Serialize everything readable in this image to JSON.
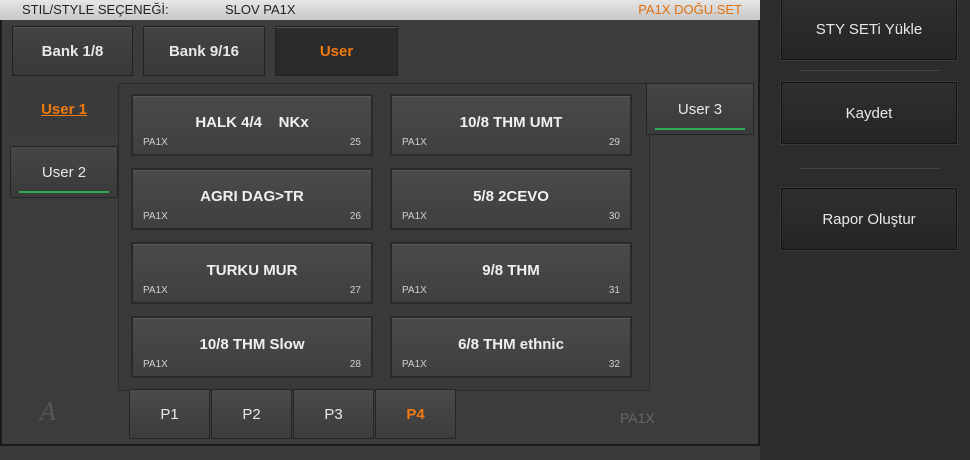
{
  "title": {
    "mode_label": "STIL/STYLE SEÇENEĞİ:",
    "style_name": "SLOV PA1X",
    "set_name": "PA1X DOĞU.SET"
  },
  "banks": [
    {
      "label": "Bank 1/8"
    },
    {
      "label": "Bank 9/16"
    },
    {
      "label": "User",
      "active": true
    }
  ],
  "user_tabs": [
    {
      "label": "User 1",
      "selected": true
    },
    {
      "label": "User 2"
    },
    {
      "label": "User 3"
    }
  ],
  "slots": [
    {
      "name": "HALK 4/4    NKx",
      "source": "PA1X",
      "number": "25"
    },
    {
      "name": "10/8 THM UMT",
      "source": "PA1X",
      "number": "29"
    },
    {
      "name": "AGRI DAG>TR",
      "source": "PA1X",
      "number": "26"
    },
    {
      "name": "5/8 2CEVO",
      "source": "PA1X",
      "number": "30"
    },
    {
      "name": "TURKU MUR",
      "source": "PA1X",
      "number": "27"
    },
    {
      "name": "9/8 THM",
      "source": "PA1X",
      "number": "31"
    },
    {
      "name": "10/8 THM Slow",
      "source": "PA1X",
      "number": "28"
    },
    {
      "name": "6/8 THM ethnic",
      "source": "PA1X",
      "number": "32"
    }
  ],
  "pages": [
    {
      "label": "P1"
    },
    {
      "label": "P2"
    },
    {
      "label": "P3"
    },
    {
      "label": "P4",
      "active": true
    }
  ],
  "logo_letter": "A",
  "brand": "PA1X",
  "actions": {
    "load_sty_set": "STY  SETi  Yükle",
    "save": "Kaydet",
    "create_report": "Rapor Oluştur"
  },
  "colors": {
    "accent": "#f07a10",
    "selected_line": "#33aa55"
  }
}
